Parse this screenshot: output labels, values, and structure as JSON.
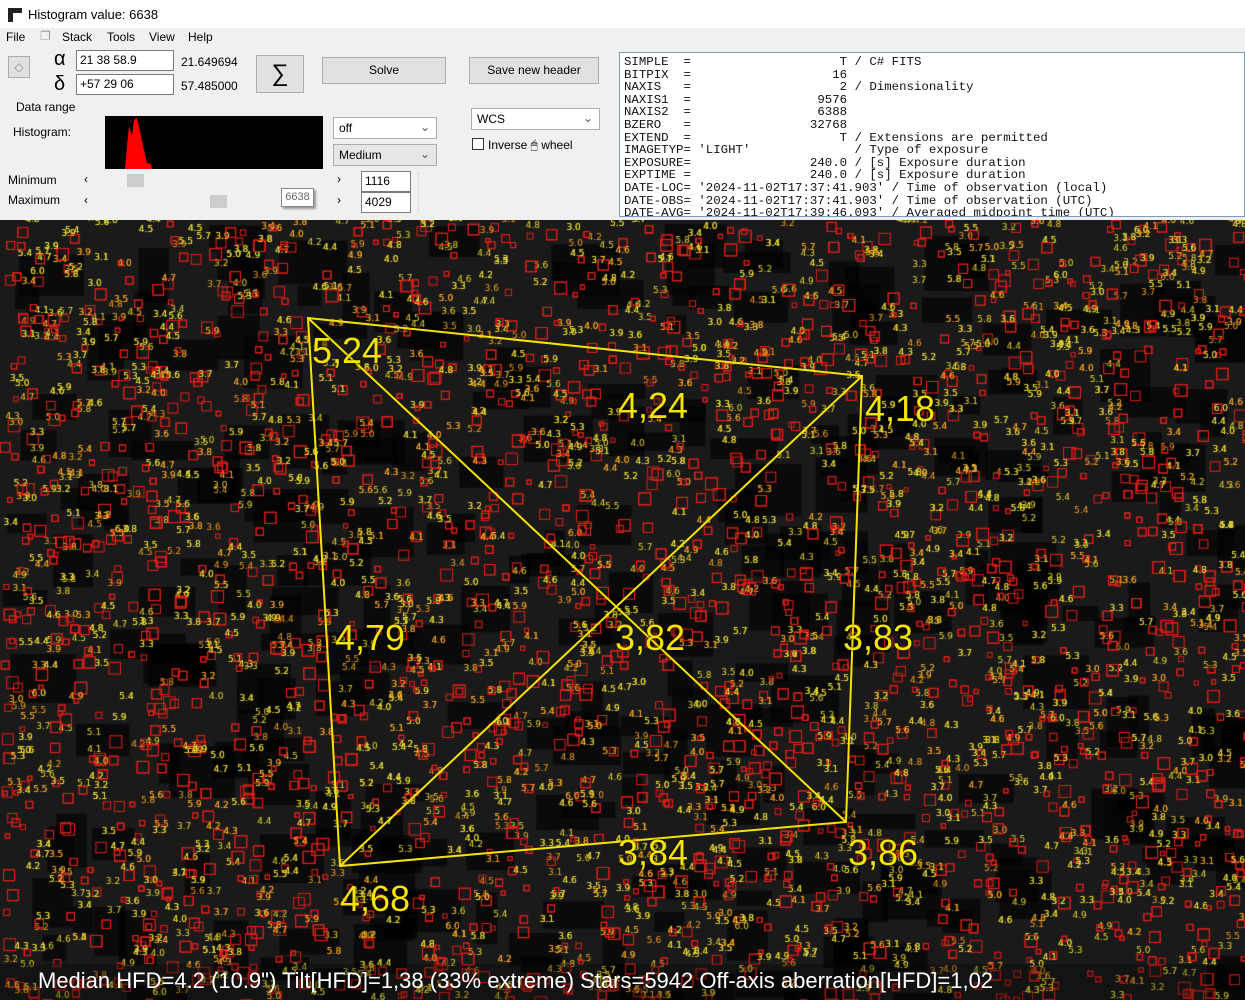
{
  "window": {
    "title": "Histogram value: 6638"
  },
  "menu": [
    "File",
    "Stack",
    "Tools",
    "View",
    "Help"
  ],
  "coords": {
    "alpha_symbol": "α",
    "delta_symbol": "δ",
    "ra_input": "21 38 58.9",
    "ra_decimal": "21.649694",
    "dec_input": "+57 29 06",
    "dec_decimal": "57.485000"
  },
  "buttons": {
    "sigma": "∑",
    "solve": "Solve",
    "save_header": "Save new header"
  },
  "labels": {
    "data_range": "Data range",
    "histogram": "Histogram:",
    "minimum": "Minimum",
    "maximum": "Maximum",
    "inverse_wheel": "Inverse 🖱 wheel"
  },
  "selects": {
    "stretch": "off",
    "level": "Medium",
    "wcs": "WCS"
  },
  "range": {
    "min": "1116",
    "max": "4029",
    "tooltip": "6638",
    "min_slider_fraction": 0.14,
    "max_slider_fraction": 0.5
  },
  "histogram_color": "#ff0000",
  "fits_header": [
    "SIMPLE  =                    T / C# FITS",
    "BITPIX  =                   16",
    "NAXIS   =                    2 / Dimensionality",
    "NAXIS1  =                 9576",
    "NAXIS2  =                 6388",
    "BZERO   =                32768",
    "EXTEND  =                    T / Extensions are permitted",
    "IMAGETYP= 'LIGHT'              / Type of exposure",
    "EXPOSURE=                240.0 / [s] Exposure duration",
    "EXPTIME =                240.0 / [s] Exposure duration",
    "DATE-LOC= '2024-11-02T17:37:41.903' / Time of observation (local)",
    "DATE-OBS= '2024-11-02T17:37:41.903' / Time of observation (UTC)",
    "DATE-AVG= '2024-11-02T17:39:46.093' / Averaged midpoint time (UTC)"
  ],
  "tilt": {
    "color": "#f5e400",
    "labels": {
      "top_left": "5,24",
      "top": "4,24",
      "top_right": "4,18",
      "left": "4,79",
      "center": "3,82",
      "right": "3,83",
      "bottom": "3,84",
      "bottom_right": "3,86",
      "bottom_left": "4,68"
    }
  },
  "status": "Median HFD=4.2 (10.9\")  Tilt[HFD]=1,38 (33% extreme)  Stars=5942  Off-axis aberration[HFD]=1,02"
}
